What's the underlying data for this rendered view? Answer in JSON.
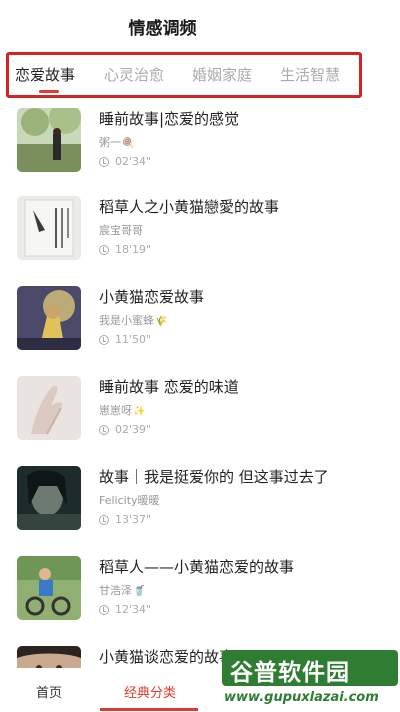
{
  "header": {
    "title": "情感调频"
  },
  "tabs": [
    {
      "label": "恋爱故事"
    },
    {
      "label": "心灵治愈"
    },
    {
      "label": "婚姻家庭"
    },
    {
      "label": "生活智慧"
    }
  ],
  "items": [
    {
      "title": "睡前故事|恋爱的感觉",
      "author": "粥一",
      "author_emoji": "🍭",
      "duration": "02'34\""
    },
    {
      "title": "稻草人之小黄猫戀愛的故事",
      "author": "宸宝哥哥",
      "author_emoji": "",
      "duration": "18'19\""
    },
    {
      "title": "小黄猫恋爱故事",
      "author": "我是小蜜蜂",
      "author_emoji": "🌾",
      "duration": "11'50\""
    },
    {
      "title": "睡前故事 恋爱的味道",
      "author": "崽崽呀",
      "author_emoji": "✨",
      "duration": "02'39\""
    },
    {
      "title": "故事｜我是挺爱你的 但这事过去了",
      "author": "Felicity暖暖",
      "author_emoji": "",
      "duration": "13'37\""
    },
    {
      "title": "稻草人——小黄猫恋爱的故事",
      "author": "甘浩泽",
      "author_emoji": "🥤",
      "duration": "12'34\""
    },
    {
      "title": "小黄猫谈恋爱的故事",
      "author": "",
      "author_emoji": "",
      "duration": ""
    }
  ],
  "bottom_nav": [
    {
      "label": "首页"
    },
    {
      "label": "经典分类"
    }
  ],
  "watermark": {
    "text": "谷普软件园",
    "url": "www.gupuxlazai.com"
  },
  "colors": {
    "accent": "#e03a2f",
    "highlight_box": "#d42424",
    "watermark_green": "#2f7d32"
  }
}
